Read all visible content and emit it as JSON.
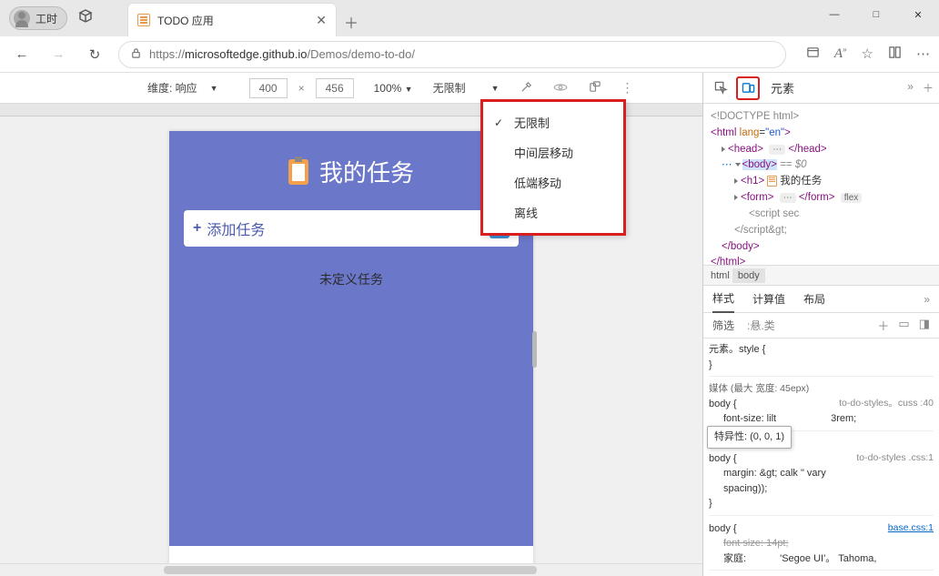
{
  "titlebar": {
    "profile_label": "工时",
    "tab_title": "TODO 应用"
  },
  "winctrl": {
    "min": "—",
    "max": "□",
    "close": "✕"
  },
  "address": {
    "lock": "🔒",
    "url_gray1": "https://",
    "url_dark": "microsoftedge.github.io",
    "url_gray2": "/Demos/demo-to-do/"
  },
  "devbar": {
    "dim_label": "维度: 响应",
    "width": "400",
    "times": "×",
    "height": "456",
    "zoom": "100%",
    "throttle": "无限制"
  },
  "throttle_menu": {
    "opt0": "无限制",
    "opt1": "中间层移动",
    "opt2": "低端移动",
    "opt3": "离线"
  },
  "app": {
    "title": "我的任务",
    "add_placeholder": "添加任务",
    "empty": "未定义任务"
  },
  "dt_tabs": {
    "elements": "元素"
  },
  "dom": {
    "doctype": "<!DOCTYPE html>",
    "html_open": "<html lang=\"en\">",
    "head_open": "<head>",
    "head_dots": "⋯",
    "head_close": "</head>",
    "body_open": "<body>",
    "body_eq": " == $0",
    "h1_open": "<h1>",
    "h1_text": "我的任务",
    "form_open": "<form>",
    "form_dots": "⋯",
    "form_close": "</form>",
    "flex_badge": "flex",
    "script": "<script sec",
    "script_close": "</script&gt;",
    "body_close": "</body>",
    "html_close": "</html>"
  },
  "crumbs": {
    "c0": "html",
    "c1": "body"
  },
  "styletabs": {
    "t0": "样式",
    "t1": "计算值",
    "t2": "布局"
  },
  "filter": {
    "label": "筛选",
    "hov": ":悬.类"
  },
  "rules": {
    "r0_sel": "元素。style {",
    "r0_close": "}",
    "media": "媒体 (最大 宽度: 45epx)",
    "r1_sel": "body {",
    "r1_src": "to-do-styles。cuss :40",
    "r1_p0": "font-size: lilt",
    "r1_trail": "3rem;",
    "tooltip": "特异性: (0, 0, 1)",
    "r2_sel": "body {",
    "r2_src": "to-do-styles .css:1",
    "r2_p0": "margin: &gt; calk \" vary",
    "r2_p1": "spacing));",
    "r2_close": "}",
    "r3_sel": "body {",
    "r3_src": "base.css:1",
    "r3_p0": "font size: 14pt;",
    "r3_p1l": "家庭:",
    "r3_p1r": "'Segoe       UI'。  Tahoma,"
  }
}
